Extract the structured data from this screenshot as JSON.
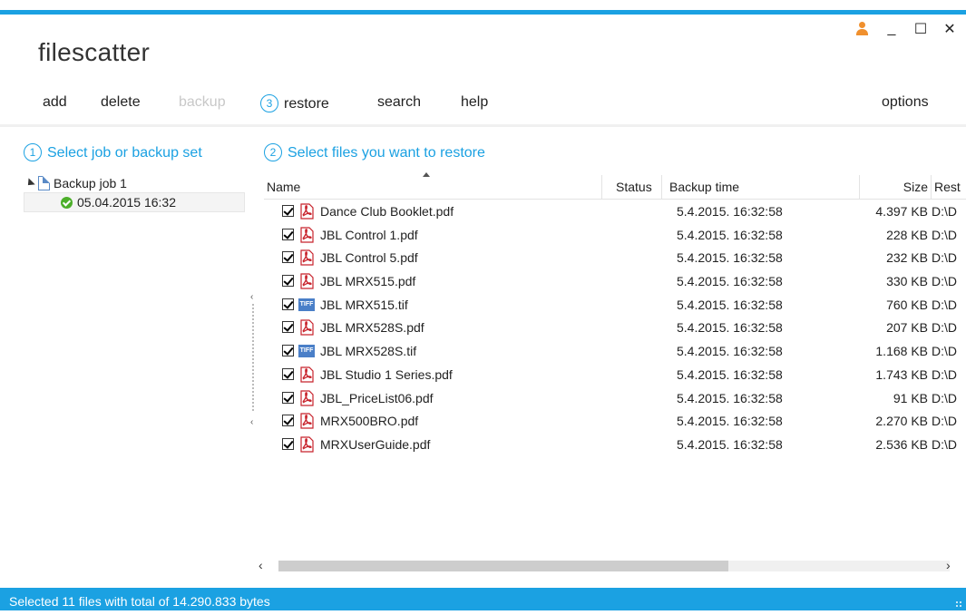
{
  "app": {
    "title": "filescatter"
  },
  "window_controls": {
    "user_icon": "user-icon",
    "minimize": "_",
    "maximize": "☐",
    "close": "✕"
  },
  "menu": {
    "add": "add",
    "delete": "delete",
    "backup": "backup",
    "restore_step": "3",
    "restore": "restore",
    "search": "search",
    "help": "help",
    "options": "options"
  },
  "left": {
    "step": "1",
    "heading": "Select job or backup set",
    "job": "Backup job 1",
    "backup_set": "05.04.2015 16:32"
  },
  "right": {
    "step": "2",
    "heading": "Select files you want to restore",
    "columns": {
      "name": "Name",
      "status": "Status",
      "backup_time": "Backup time",
      "size": "Size",
      "restore": "Rest"
    },
    "files": [
      {
        "name": "Dance Club Booklet.pdf",
        "type": "pdf",
        "status": "",
        "time": "5.4.2015. 16:32:58",
        "size": "4.397 KB",
        "path": "D:\\D"
      },
      {
        "name": "JBL Control 1.pdf",
        "type": "pdf",
        "status": "",
        "time": "5.4.2015. 16:32:58",
        "size": "228 KB",
        "path": "D:\\D"
      },
      {
        "name": "JBL Control 5.pdf",
        "type": "pdf",
        "status": "",
        "time": "5.4.2015. 16:32:58",
        "size": "232 KB",
        "path": "D:\\D"
      },
      {
        "name": "JBL MRX515.pdf",
        "type": "pdf",
        "status": "",
        "time": "5.4.2015. 16:32:58",
        "size": "330 KB",
        "path": "D:\\D"
      },
      {
        "name": "JBL MRX515.tif",
        "type": "tif",
        "status": "",
        "time": "5.4.2015. 16:32:58",
        "size": "760 KB",
        "path": "D:\\D"
      },
      {
        "name": "JBL MRX528S.pdf",
        "type": "pdf",
        "status": "",
        "time": "5.4.2015. 16:32:58",
        "size": "207 KB",
        "path": "D:\\D"
      },
      {
        "name": "JBL MRX528S.tif",
        "type": "tif",
        "status": "",
        "time": "5.4.2015. 16:32:58",
        "size": "1.168 KB",
        "path": "D:\\D"
      },
      {
        "name": "JBL Studio 1 Series.pdf",
        "type": "pdf",
        "status": "",
        "time": "5.4.2015. 16:32:58",
        "size": "1.743 KB",
        "path": "D:\\D"
      },
      {
        "name": "JBL_PriceList06.pdf",
        "type": "pdf",
        "status": "",
        "time": "5.4.2015. 16:32:58",
        "size": "91 KB",
        "path": "D:\\D"
      },
      {
        "name": "MRX500BRO.pdf",
        "type": "pdf",
        "status": "",
        "time": "5.4.2015. 16:32:58",
        "size": "2.270 KB",
        "path": "D:\\D"
      },
      {
        "name": "MRXUserGuide.pdf",
        "type": "pdf",
        "status": "",
        "time": "5.4.2015. 16:32:58",
        "size": "2.536 KB",
        "path": "D:\\D"
      }
    ]
  },
  "scroll": {
    "left": "‹",
    "right": "›"
  },
  "status": {
    "text": "Selected 11 files with total of 14.290.833 bytes"
  },
  "colors": {
    "accent": "#1ba1e2",
    "user_icon": "#f0902e",
    "ok": "#4caf2a"
  },
  "tif_icon_text": "TIFF"
}
